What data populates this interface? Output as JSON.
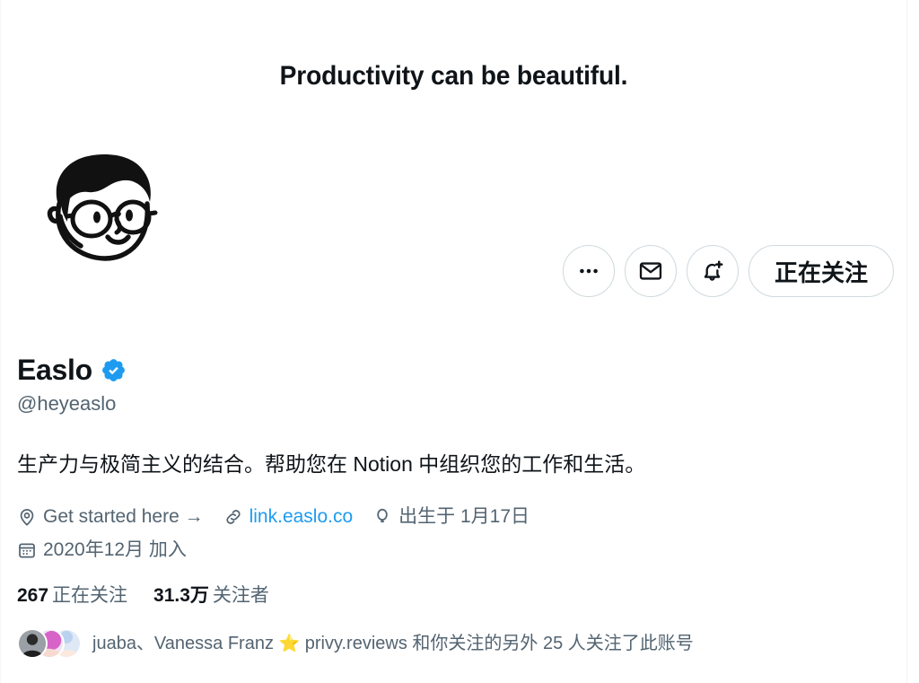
{
  "banner": {
    "text": "Productivity can be beautiful."
  },
  "avatar": {
    "alt": "Easlo cartoon face avatar"
  },
  "actions": {
    "more_label": "•••",
    "more_icon": "more-horizontal-icon",
    "message_icon": "envelope-icon",
    "notify_icon": "bell-plus-icon",
    "follow_label": "正在关注"
  },
  "profile": {
    "display_name": "Easlo",
    "verified": true,
    "verified_icon": "verified-badge-icon",
    "handle": "@heyeaslo",
    "bio": "生产力与极简主义的结合。帮助您在 Notion 中组织您的工作和生活。"
  },
  "meta": {
    "location_icon": "location-pin-icon",
    "location": "Get started here →",
    "link_icon": "chain-link-icon",
    "link": "link.easlo.co",
    "birthday_icon": "balloon-icon",
    "birthday": "出生于 1月17日",
    "joined_icon": "calendar-icon",
    "joined": "2020年12月 加入"
  },
  "stats": {
    "following_count": "267",
    "following_label": "正在关注",
    "followers_count": "31.3万",
    "followers_label": "关注者"
  },
  "followed_by": {
    "prefix": "juaba、Vanessa Franz ",
    "star": "⭐",
    "middle": " privy.reviews 和你关注的另外 25 人关注了此账号",
    "avatar_count": 3
  },
  "colors": {
    "accent_blue": "#1d9bf0",
    "text_primary": "#0f1419",
    "text_secondary": "#536471",
    "border": "#cfd9de",
    "star_gold": "#f0a63a"
  }
}
